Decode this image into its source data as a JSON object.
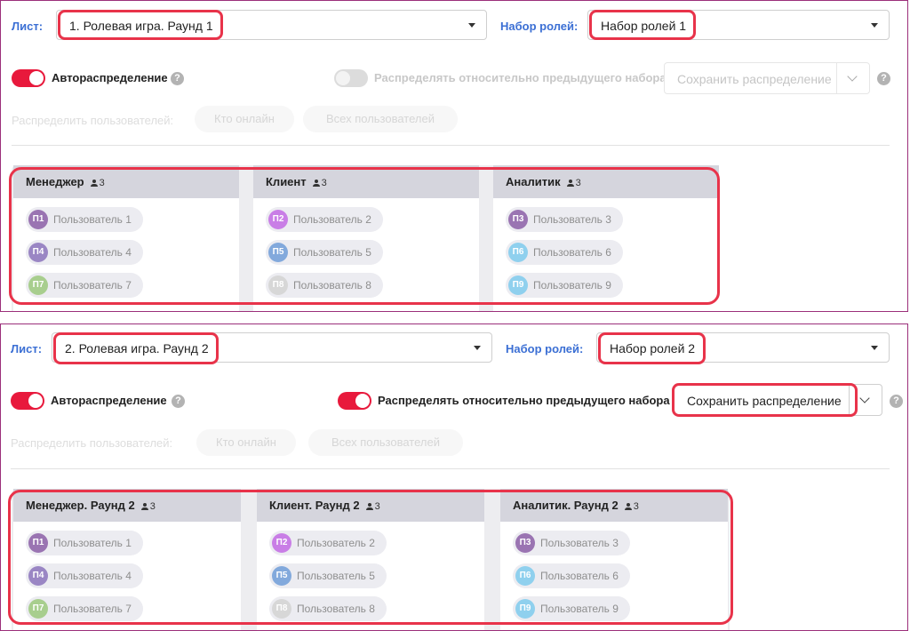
{
  "screen1": {
    "sheet_label": "Лист:",
    "sheet_value": "1. Ролевая игра. Раунд 1",
    "roleset_label": "Набор ролей:",
    "roleset_value": "Набор ролей 1",
    "auto_label": "Автораспределение",
    "auto_on": true,
    "relative_label": "Распределять относительно предыдущего набора",
    "relative_on": false,
    "save_label": "Сохранить распределение",
    "help_glyph": "?",
    "distribute_label": "Распределить пользователей:",
    "online_btn": "Кто онлайн",
    "all_btn": "Всех пользователей",
    "columns": [
      {
        "title": "Менеджер",
        "count": "3",
        "users": [
          {
            "initials": "П1",
            "name": "Пользователь 1",
            "color": "#9a74b2"
          },
          {
            "initials": "П4",
            "name": "Пользователь 4",
            "color": "#9a86c4"
          },
          {
            "initials": "П7",
            "name": "Пользователь 7",
            "color": "#a8ce8e"
          }
        ]
      },
      {
        "title": "Клиент",
        "count": "3",
        "users": [
          {
            "initials": "П2",
            "name": "Пользователь 2",
            "color": "#c97ee6"
          },
          {
            "initials": "П5",
            "name": "Пользователь 5",
            "color": "#82a9dc"
          },
          {
            "initials": "П8",
            "name": "Пользователь 8",
            "color": "#d7d7d7"
          }
        ]
      },
      {
        "title": "Аналитик",
        "count": "3",
        "users": [
          {
            "initials": "П3",
            "name": "Пользователь 3",
            "color": "#9a74b2"
          },
          {
            "initials": "П6",
            "name": "Пользователь 6",
            "color": "#8fd0ee"
          },
          {
            "initials": "П9",
            "name": "Пользователь 9",
            "color": "#8fd0ee"
          }
        ]
      }
    ]
  },
  "screen2": {
    "sheet_label": "Лист:",
    "sheet_value": "2. Ролевая игра. Раунд 2",
    "roleset_label": "Набор ролей:",
    "roleset_value": "Набор ролей 2",
    "auto_label": "Автораспределение",
    "auto_on": true,
    "relative_label": "Распределять относительно предыдущего набора",
    "relative_on": true,
    "save_label": "Сохранить распределение",
    "help_glyph": "?",
    "distribute_label": "Распределить пользователей:",
    "online_btn": "Кто онлайн",
    "all_btn": "Всех пользователей",
    "columns": [
      {
        "title": "Менеджер. Раунд 2",
        "count": "3",
        "users": [
          {
            "initials": "П1",
            "name": "Пользователь 1",
            "color": "#9a74b2"
          },
          {
            "initials": "П4",
            "name": "Пользователь 4",
            "color": "#9a86c4"
          },
          {
            "initials": "П7",
            "name": "Пользователь 7",
            "color": "#a8ce8e"
          }
        ]
      },
      {
        "title": "Клиент. Раунд 2",
        "count": "3",
        "users": [
          {
            "initials": "П2",
            "name": "Пользователь 2",
            "color": "#c97ee6"
          },
          {
            "initials": "П5",
            "name": "Пользователь 5",
            "color": "#82a9dc"
          },
          {
            "initials": "П8",
            "name": "Пользователь 8",
            "color": "#d7d7d7"
          }
        ]
      },
      {
        "title": "Аналитик. Раунд 2",
        "count": "3",
        "users": [
          {
            "initials": "П3",
            "name": "Пользователь 3",
            "color": "#9a74b2"
          },
          {
            "initials": "П6",
            "name": "Пользователь 6",
            "color": "#8fd0ee"
          },
          {
            "initials": "П9",
            "name": "Пользователь 9",
            "color": "#8fd0ee"
          }
        ]
      }
    ]
  },
  "colors": {
    "accent": "#e8193c",
    "highlight": "#e8334a",
    "label_blue": "#3b6fd4",
    "frame": "#9b2f7a"
  }
}
